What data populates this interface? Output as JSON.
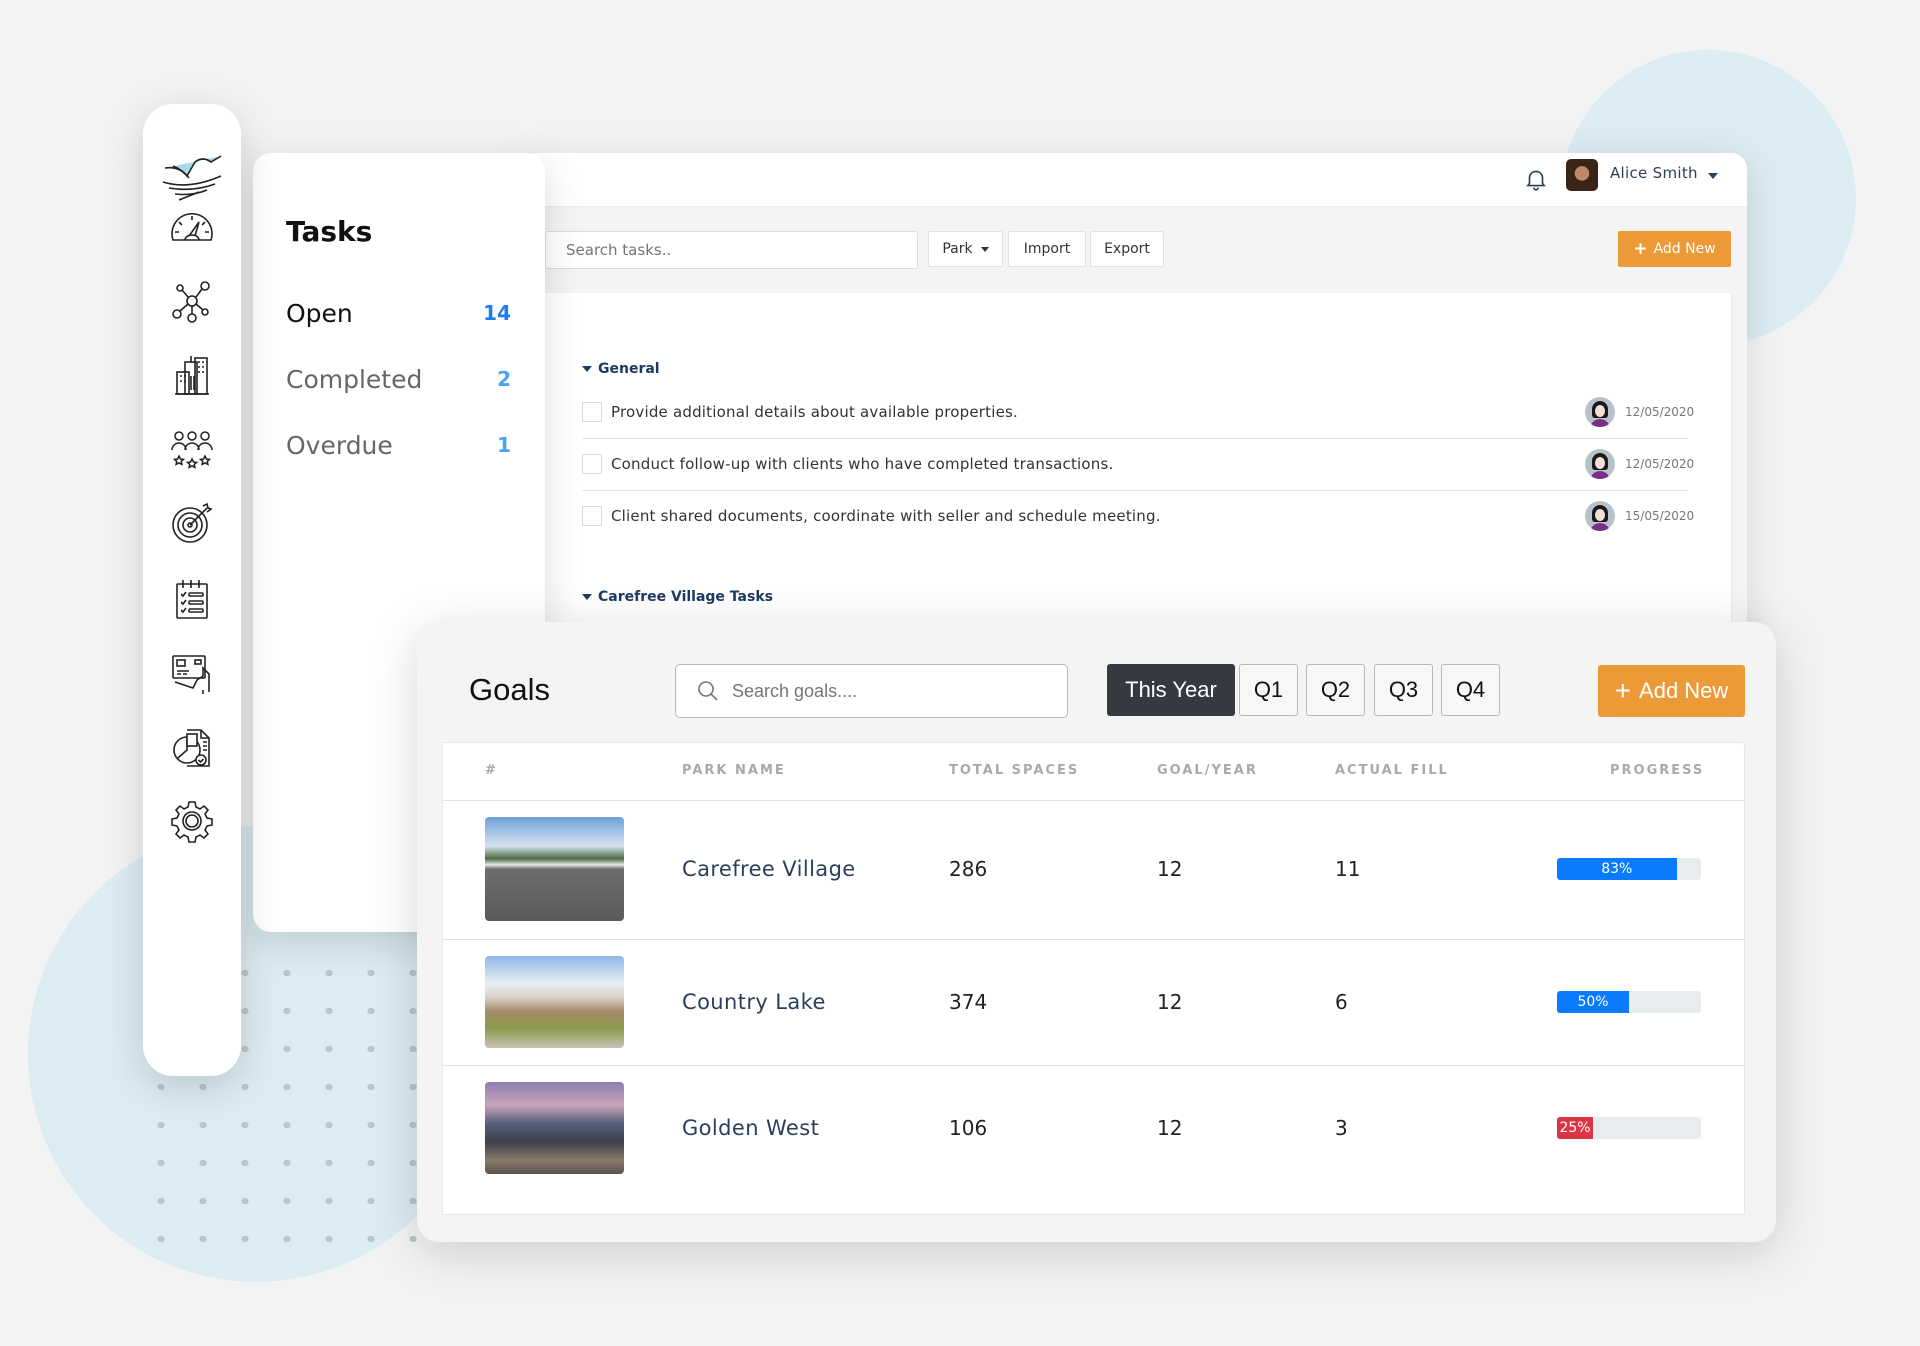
{
  "user": {
    "name": "Alice Smith",
    "notifications_icon": "bell-icon"
  },
  "sidebar": {
    "logo": "bird-nest-logo",
    "items": [
      {
        "id": "dashboard",
        "icon": "speedometer-icon"
      },
      {
        "id": "network",
        "icon": "network-icon"
      },
      {
        "id": "properties",
        "icon": "buildings-icon"
      },
      {
        "id": "residents",
        "icon": "users-rating-icon"
      },
      {
        "id": "goals",
        "icon": "target-icon"
      },
      {
        "id": "tasks",
        "icon": "checklist-icon"
      },
      {
        "id": "payments",
        "icon": "card-payment-icon"
      },
      {
        "id": "reports",
        "icon": "report-chart-icon"
      },
      {
        "id": "settings",
        "icon": "gear-icon"
      }
    ]
  },
  "tasks_panel": {
    "title": "Tasks",
    "filters": [
      {
        "label": "Open",
        "count": "14",
        "active": true
      },
      {
        "label": "Completed",
        "count": "2",
        "active": false
      },
      {
        "label": "Overdue",
        "count": "1",
        "active": false
      }
    ]
  },
  "task_toolbar": {
    "search_placeholder": "Search tasks..",
    "park_label": "Park",
    "import_label": "Import",
    "export_label": "Export",
    "add_label": "Add New"
  },
  "task_groups": [
    {
      "title": "General",
      "tasks": [
        {
          "text": "Provide additional details about available properties.",
          "date": "12/05/2020",
          "checked": false
        },
        {
          "text": "Conduct follow-up with clients who have completed transactions.",
          "date": "12/05/2020",
          "checked": false
        },
        {
          "text": "Client shared documents, coordinate with seller and schedule meeting.",
          "date": "15/05/2020",
          "checked": false
        }
      ]
    },
    {
      "title": "Carefree Village Tasks",
      "tasks": []
    }
  ],
  "goals": {
    "title": "Goals",
    "search_placeholder": "Search goals....",
    "periods": [
      {
        "label": "This Year",
        "active": true
      },
      {
        "label": "Q1",
        "active": false
      },
      {
        "label": "Q2",
        "active": false
      },
      {
        "label": "Q3",
        "active": false
      },
      {
        "label": "Q4",
        "active": false
      }
    ],
    "add_label": "Add New",
    "columns": [
      "#",
      "PARK NAME",
      "TOTAL SPACES",
      "GOAL/YEAR",
      "ACTUAL FILL",
      "PROGRESS"
    ],
    "rows": [
      {
        "image": "carefree-village-photo",
        "park_name": "Carefree Village",
        "total_spaces": "286",
        "goal_year": "12",
        "actual_fill": "11",
        "progress": 83,
        "progress_label": "83%",
        "progress_color": "#0a7bff"
      },
      {
        "image": "country-lake-photo",
        "park_name": "Country Lake",
        "total_spaces": "374",
        "goal_year": "12",
        "actual_fill": "6",
        "progress": 50,
        "progress_label": "50%",
        "progress_color": "#0a7bff"
      },
      {
        "image": "golden-west-photo",
        "park_name": "Golden West",
        "total_spaces": "106",
        "goal_year": "12",
        "actual_fill": "3",
        "progress": 25,
        "progress_label": "25%",
        "progress_color": "#dc3545"
      }
    ]
  },
  "colors": {
    "accent_orange": "#ec9a38",
    "primary_blue": "#0a7bff",
    "danger_red": "#dc3545",
    "navy": "#1e3a64",
    "dark_button": "#343a40"
  }
}
